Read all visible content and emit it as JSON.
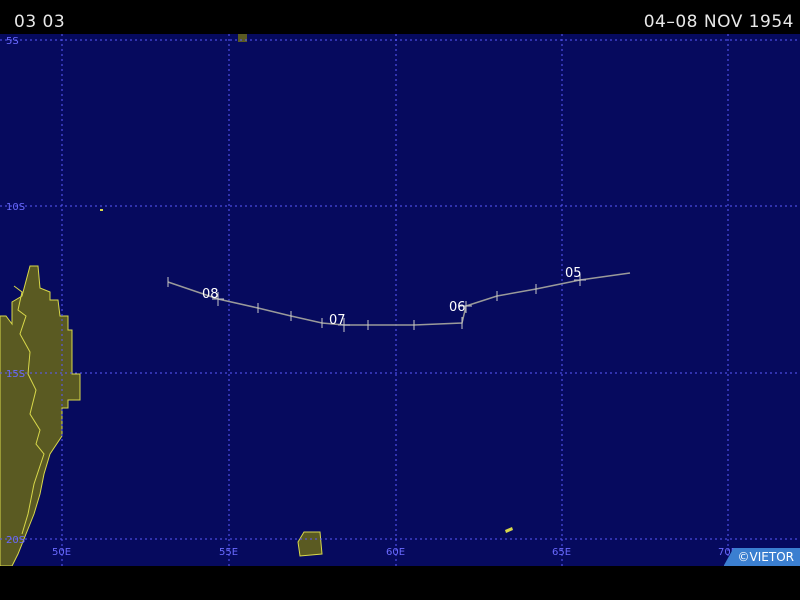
{
  "header": {
    "left_text": "03 03",
    "right_text": "04–08 NOV 1954"
  },
  "map": {
    "ocean_color": "#060a5e",
    "land_color": "#5a5a22",
    "coast_color": "#d8d84a",
    "grid_color": "#5a5aff",
    "track_color": "#9a9a9a",
    "lat_labels": [
      "5S",
      "10S",
      "15S",
      "20S"
    ],
    "lon_labels": [
      "50E",
      "55E",
      "60E",
      "65E",
      "70E"
    ],
    "day_labels": [
      "08",
      "07",
      "06",
      "05"
    ]
  },
  "credit": {
    "text": "©VIETOR"
  }
}
